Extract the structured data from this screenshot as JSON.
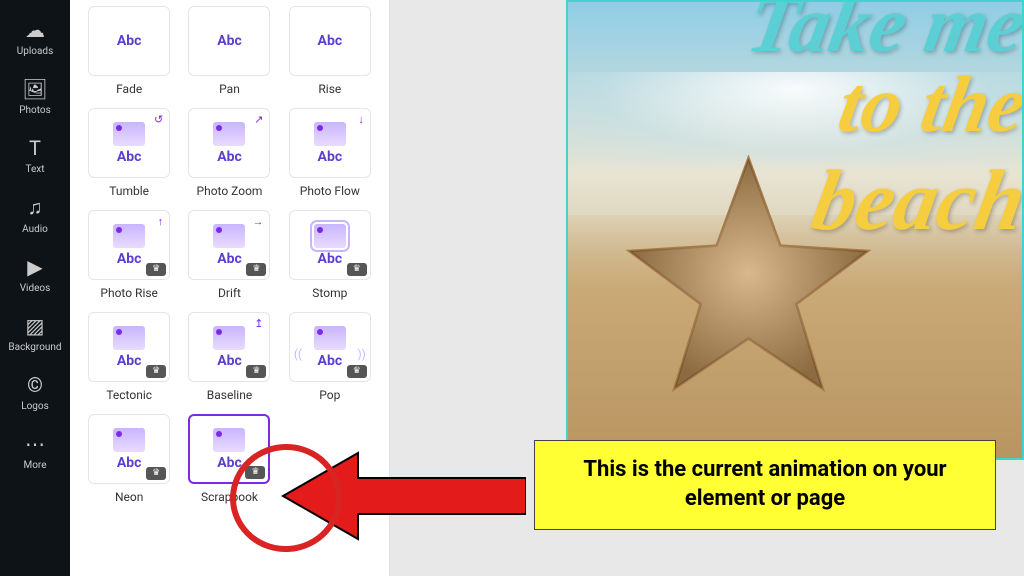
{
  "sidebar": {
    "items": [
      {
        "label": "Uploads",
        "icon": "☁"
      },
      {
        "label": "Photos",
        "icon": "🖼"
      },
      {
        "label": "Text",
        "icon": "T"
      },
      {
        "label": "Audio",
        "icon": "♫"
      },
      {
        "label": "Videos",
        "icon": "▶"
      },
      {
        "label": "Background",
        "icon": "▨"
      },
      {
        "label": "Logos",
        "icon": "©"
      },
      {
        "label": "More",
        "icon": "⋯"
      }
    ]
  },
  "animations": {
    "preview_text": "Abc",
    "items": [
      {
        "label": "Fade",
        "crown": false
      },
      {
        "label": "Pan",
        "crown": false
      },
      {
        "label": "Rise",
        "crown": false
      },
      {
        "label": "Tumble",
        "crown": false,
        "corner": "↺"
      },
      {
        "label": "Photo Zoom",
        "crown": false,
        "corner": "↗"
      },
      {
        "label": "Photo Flow",
        "crown": false,
        "corner": "↓"
      },
      {
        "label": "Photo Rise",
        "crown": true,
        "corner": "↑"
      },
      {
        "label": "Drift",
        "crown": true,
        "corner": "→"
      },
      {
        "label": "Stomp",
        "crown": true
      },
      {
        "label": "Tectonic",
        "crown": true
      },
      {
        "label": "Baseline",
        "crown": true,
        "corner": "↥"
      },
      {
        "label": "Pop",
        "crown": true,
        "wave": true
      },
      {
        "label": "Neon",
        "crown": true
      },
      {
        "label": "Scrapbook",
        "crown": true,
        "selected": true
      }
    ]
  },
  "canvas": {
    "text1": "Take me",
    "text2": "to the",
    "text3": "beach"
  },
  "callout": {
    "text": "This is the current animation on your element or page"
  }
}
